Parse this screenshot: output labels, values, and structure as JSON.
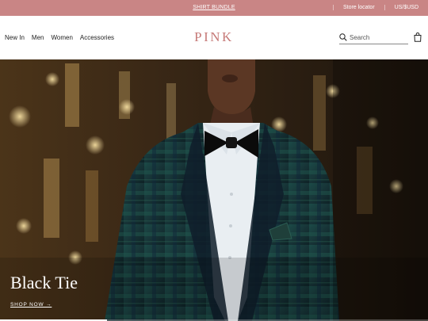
{
  "promo": {
    "bundle_link": "SHIRT BUNDLE",
    "store_locator": "Store locator",
    "currency": "US/$USD"
  },
  "header": {
    "logo": "PINK",
    "nav": [
      "New In",
      "Men",
      "Women",
      "Accessories"
    ],
    "search_placeholder": "Search",
    "icons": {
      "search": "search-icon",
      "bag": "shopping-bag-icon"
    }
  },
  "hero": {
    "title": "Black Tie",
    "cta": "SHOP NOW →",
    "progress": 0.25,
    "colors": {
      "jacket": "#173437",
      "lapel": "#0f1d2a",
      "shirt": "#e9eef2",
      "bowtie": "#0b0b0b",
      "background": "#3a2816",
      "lights": "#e7c98a"
    }
  },
  "colors": {
    "promo_bar": "#c98585",
    "logo": "#c67a78"
  }
}
